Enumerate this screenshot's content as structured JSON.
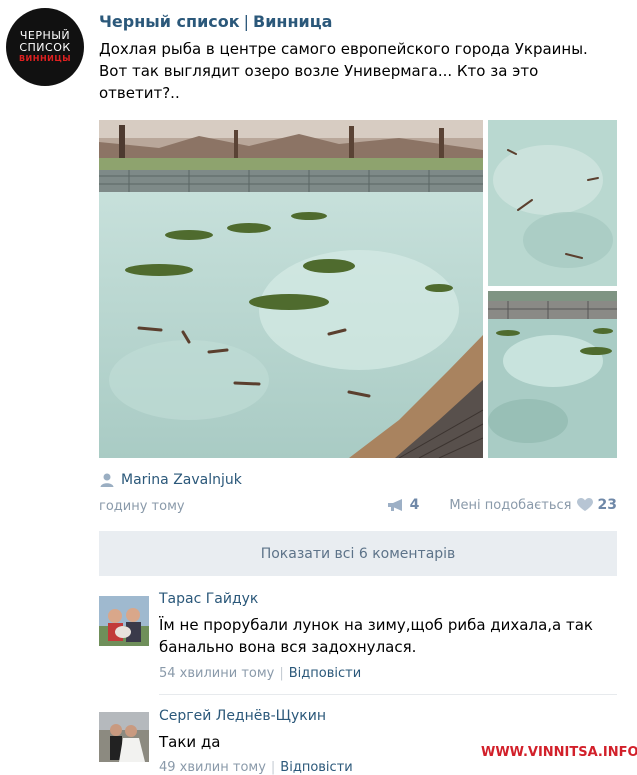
{
  "group": {
    "name": "Черный список",
    "separator": "|",
    "city": "Винница",
    "logo": {
      "line1": "ЧЕРНЫЙ",
      "line2": "СПИСОК",
      "line3": "ВИННИЦЫ"
    }
  },
  "post": {
    "text": "Дохлая рыба в центре самого европейского города Украины. Вот так выглядит озеро возле Универмага... Кто за это ответит?..",
    "author": "Marina Zavalnjuk",
    "time": "годину тому",
    "reposts": "4",
    "like_label": "Мені подобається",
    "likes": "23"
  },
  "comments_toggle": {
    "label": "Показати всі 6 коментарів"
  },
  "comments": [
    {
      "author": "Тарас Гайдук",
      "text": "Їм не прорубали лунок на зиму,щоб риба дихала,а так банально вона вся задохнулася.",
      "time": "54 хвилини тому",
      "reply_label": "Відповісти"
    },
    {
      "author": "Сергей Леднёв-Щукин",
      "text": "Таки да",
      "time": "49 хвилин тому",
      "reply_label": "Відповісти"
    }
  ],
  "watermark": "WWW.VINNITSA.INFO",
  "colors": {
    "link": "#2b587a",
    "muted": "#8a9aaa",
    "button_bg": "#e9edf1",
    "watermark": "#d2202a"
  },
  "icons": {
    "author": "person-icon",
    "repost": "megaphone-icon",
    "like": "heart-icon"
  }
}
